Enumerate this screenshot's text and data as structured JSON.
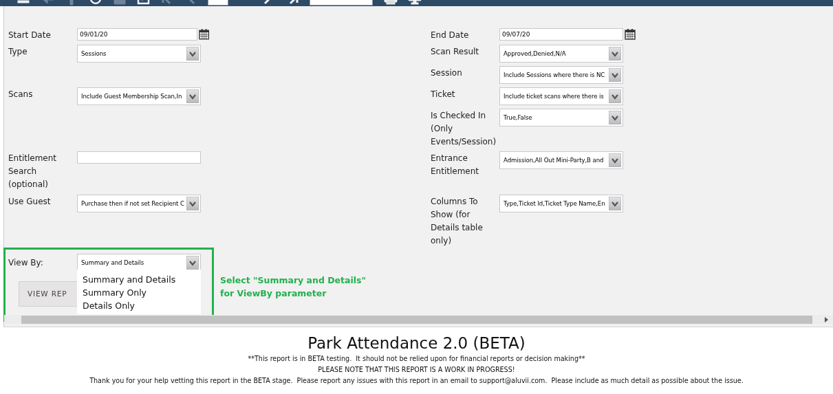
{
  "toolbar": {
    "buttons": [
      {
        "kind": "menu",
        "disabled": false
      },
      {
        "kind": "back",
        "disabled": true
      },
      {
        "kind": "up",
        "disabled": true
      },
      {
        "kind": "refresh",
        "disabled": false
      },
      {
        "kind": "list",
        "disabled": true
      },
      {
        "kind": "export",
        "disabled": false
      },
      {
        "kind": "first",
        "disabled": true
      },
      {
        "kind": "prev",
        "disabled": true
      },
      {
        "kind": "pagefield"
      },
      {
        "kind": "next",
        "disabled": false
      },
      {
        "kind": "last",
        "disabled": false
      },
      {
        "kind": "search"
      },
      {
        "kind": "print",
        "disabled": false
      },
      {
        "kind": "monitor",
        "disabled": false
      }
    ]
  },
  "parameters": {
    "rows": [
      {
        "left": {
          "label": "Start Date",
          "kind": "date",
          "value": "09/01/20"
        },
        "right": {
          "label": "End Date",
          "kind": "date",
          "value": "09/07/20"
        }
      },
      {
        "left": {
          "label": "Type",
          "kind": "select",
          "value": "Sessions"
        },
        "right": {
          "label": "Scan Result",
          "kind": "select",
          "value": "Approved,Denied,N/A"
        }
      },
      {
        "right": {
          "label": "Session",
          "kind": "select",
          "value": "Include Sessions where there is NC"
        }
      },
      {
        "left": {
          "label": "Scans",
          "kind": "select",
          "value": "Include Guest Membership Scan,In"
        },
        "right": {
          "label": "Ticket",
          "kind": "select",
          "value": "Include ticket scans where there is"
        }
      },
      {
        "right": {
          "label": "Is Checked In (Only Events/Session)",
          "kind": "select",
          "value": "True,False"
        }
      },
      {
        "left": {
          "label": "Entitlement Search (optional)",
          "kind": "text"
        },
        "right": {
          "label": "Entrance Entitlement",
          "kind": "select",
          "value": "Admission,All Out Mini-Party,B and"
        }
      },
      {
        "left": {
          "label": "Use Guest",
          "kind": "select",
          "value": "Purchase then if not set Recipient C"
        },
        "right": {
          "label": "Columns To Show (for Details table only)",
          "kind": "select",
          "value": "Type,Ticket Id,Ticket Type Name,En"
        }
      }
    ],
    "view_by": {
      "label": "View By:",
      "value": "Summary and Details",
      "expanded": true,
      "options": [
        "Summary and Details",
        "Summary Only",
        "Details Only"
      ]
    },
    "view_button": "VIEW REP"
  },
  "annotation": {
    "lines": [
      "Select \"Summary and Details\"",
      "for ViewBy parameter"
    ]
  },
  "report": {
    "title": "Park Attendance 2.0 (BETA)",
    "notes": [
      "**This report is in BETA testing.  It should not be relied upon for financial reports or decision making**",
      "PLEASE NOTE THAT THIS REPORT IS A WORK IN PROGRESS!",
      "Thank you for your help vetting this report in the BETA stage.  Please report any issues with this report in an email to support@aluvii.com.  Please include as much detail as possible about the issue."
    ]
  }
}
